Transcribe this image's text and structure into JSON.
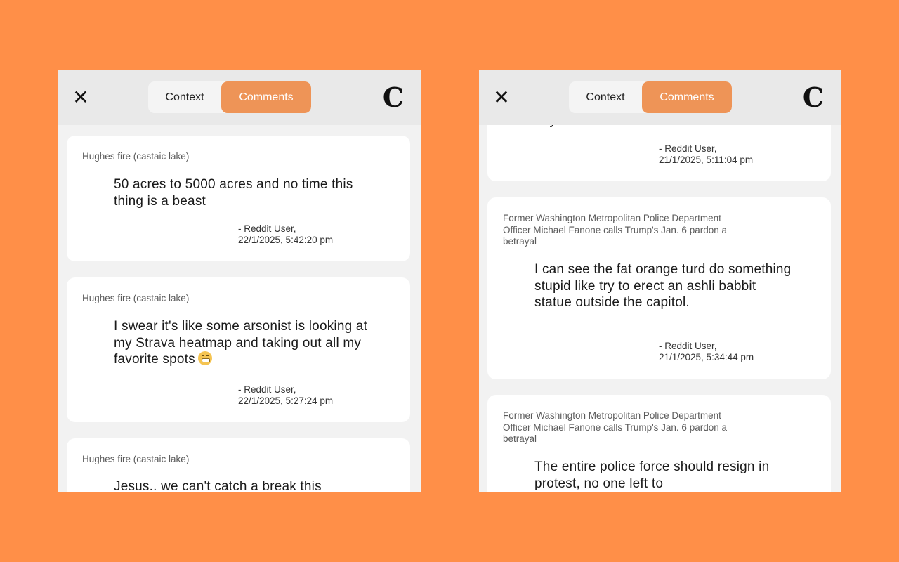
{
  "nav": {
    "close_glyph": "✕",
    "tabs": [
      "Context",
      "Comments"
    ],
    "active_tab": "Comments",
    "logo_glyph": "C"
  },
  "colors": {
    "background": "#FF8F48",
    "accent": "#EE9457",
    "panel": "#F2F2F2",
    "card": "#FFFFFF"
  },
  "left_panel": {
    "comments": [
      {
        "title": "Hughes fire (castaic lake)",
        "body": "50 acres to 5000 acres and no time this thing is a beast",
        "author": "- Reddit User,",
        "time": "22/1/2025, 5:42:20 pm"
      },
      {
        "title": "Hughes fire (castaic lake)",
        "body": "I swear it's like some arsonist is looking at my Strava heatmap and taking out all my favorite spots",
        "emoji": "grimacing-face-icon",
        "author": "- Reddit User,",
        "time": "22/1/2025, 5:27:24 pm"
      },
      {
        "title": "Hughes fire (castaic lake)",
        "body": "Jesus.. we can't catch a break this"
      }
    ]
  },
  "right_panel": {
    "comments": [
      {
        "body": "boy wants.",
        "author": "- Reddit User,",
        "time": "21/1/2025, 5:11:04 pm"
      },
      {
        "title": "Former Washington Metropolitan Police Department Officer Michael Fanone calls Trump's Jan. 6 pardon a betrayal",
        "body": "I can see the fat orange turd do something stupid like try to erect an ashli babbit statue outside the capitol.",
        "author": "- Reddit User,",
        "time": "21/1/2025, 5:34:44 pm"
      },
      {
        "title": "Former Washington Metropolitan Police Department Officer Michael Fanone calls Trump's Jan. 6 pardon a betrayal",
        "body": "The entire police force should resign in protest, no one left to"
      }
    ]
  }
}
